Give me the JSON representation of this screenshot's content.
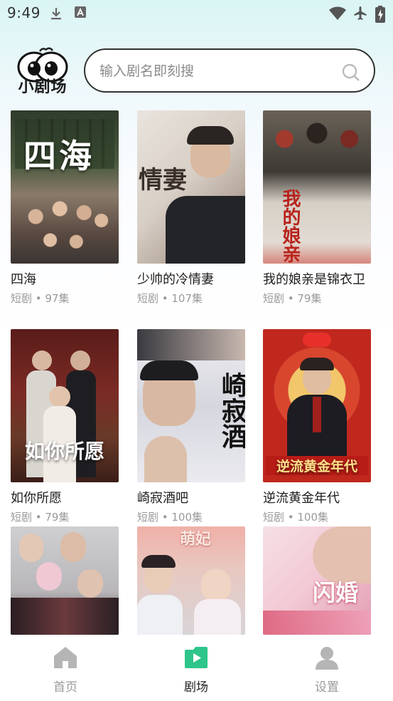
{
  "status": {
    "time": "9:49"
  },
  "logo": {
    "text": "小剧场"
  },
  "search": {
    "placeholder": "输入剧名即刻搜"
  },
  "dramas": [
    {
      "title": "四海",
      "meta": "短剧 • 97集",
      "poster_text": "四海"
    },
    {
      "title": "少帅的冷情妻",
      "meta": "短剧 • 107集",
      "poster_text": "情妻"
    },
    {
      "title": "我的娘亲是锦衣卫",
      "meta": "短剧 • 79集",
      "poster_text": "我的娘亲"
    },
    {
      "title": "如你所愿",
      "meta": "短剧 • 79集",
      "poster_text": "如你所愿"
    },
    {
      "title": "崎寂酒吧",
      "meta": "短剧 • 100集",
      "poster_text": "崎寂酒"
    },
    {
      "title": "逆流黄金年代",
      "meta": "短剧 • 100集",
      "poster_text": "逆流黄金年代"
    },
    {
      "title": "",
      "meta": "",
      "poster_text": ""
    },
    {
      "title": "",
      "meta": "",
      "poster_text": "萌妃"
    },
    {
      "title": "",
      "meta": "",
      "poster_text": "闪婚"
    }
  ],
  "tabs": [
    {
      "label": "首页",
      "active": false
    },
    {
      "label": "剧场",
      "active": true
    },
    {
      "label": "设置",
      "active": false
    }
  ],
  "colors": {
    "accent": "#2ec58a",
    "inactive": "#b5b5b5"
  }
}
